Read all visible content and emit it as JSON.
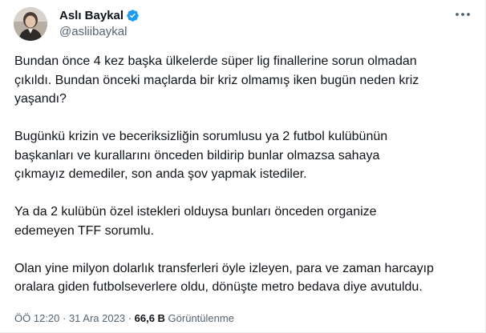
{
  "author": {
    "name": "Aslı Baykal",
    "handle": "@asliibaykal",
    "verified": true,
    "avatar_icon": "user-avatar"
  },
  "menu": {
    "icon": "more-horizontal-icon"
  },
  "tweet": {
    "paragraphs": [
      "Bundan önce 4 kez başka ülkelerde süper lig finallerine sorun olmadan\nçıkıldı. Bundan önceki maçlarda bir kriz olmamış iken bugün neden kriz\nyaşandı?",
      "Bugünkü krizin ve beceriksizliğin  sorumlusu   ya  2 futbol kulübünün\nbaşkanları ve kurallarını önceden bildirip bunlar olmazsa sahaya\nçıkmayız demediler, son anda şov yapmak istediler.",
      "Ya da 2 kulübün özel istekleri olduysa bunları önceden organize\nedemeyen TFF sorumlu.",
      "Olan yine milyon dolarlık transferleri öyle izleyen, para ve zaman harcayıp\noralara giden  futbolseverlere oldu, dönüşte metro bedava diye avutuldu."
    ]
  },
  "meta": {
    "time": "ÖÖ 12:20",
    "separator": " · ",
    "date": "31 Ara 2023",
    "views_count": "66,6 B",
    "views_label": " Görüntülenme"
  },
  "colors": {
    "text": "#0f1419",
    "secondary": "#536471",
    "verified_blue": "#1d9bf0"
  }
}
